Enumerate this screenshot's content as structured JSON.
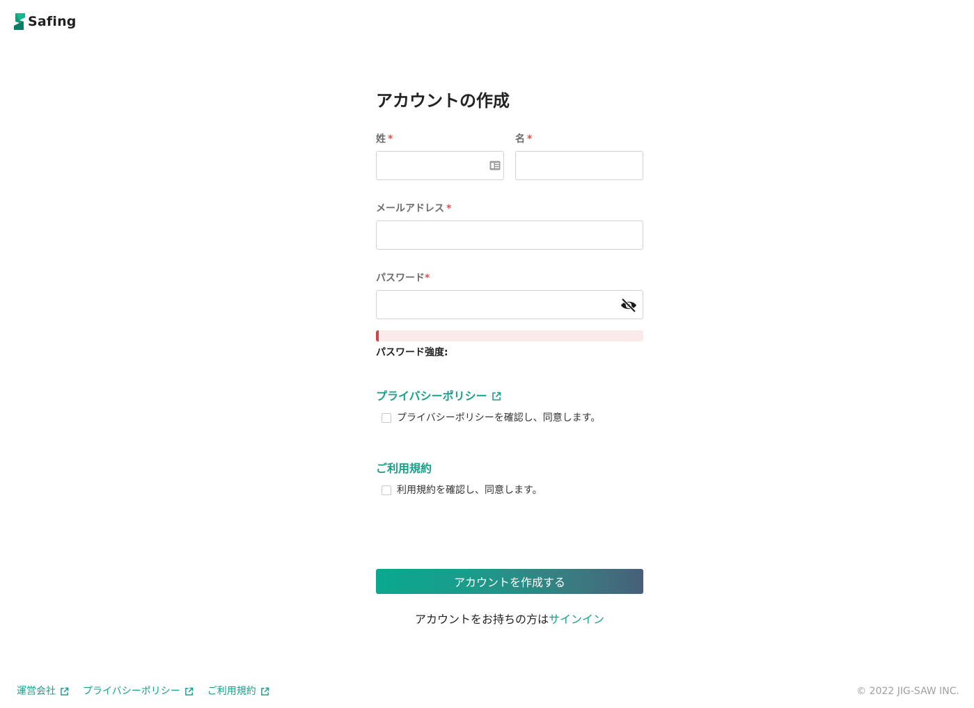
{
  "brand": {
    "name": "Safing",
    "icon": "safing-logo-icon",
    "accent": "#16a08a"
  },
  "form": {
    "title": "アカウントの作成",
    "last_name": {
      "label": "姓",
      "required_mark": "*",
      "value": "",
      "icon": "contact-card-icon"
    },
    "first_name": {
      "label": "名",
      "required_mark": "*",
      "value": ""
    },
    "email": {
      "label": "メールアドレス",
      "required_mark": "*",
      "value": ""
    },
    "password": {
      "label": "パスワード",
      "required_mark": "*",
      "value": "",
      "toggle_icon": "eye-off-icon"
    },
    "strength": {
      "label": "パスワード強度:",
      "level": 0.01,
      "color": "#cc4444",
      "track_color": "#faeaea"
    },
    "privacy": {
      "link": "プライバシーポリシー",
      "checkbox_label": "プライバシーポリシーを確認し、同意します。",
      "checked": false
    },
    "terms": {
      "link": "ご利用規約",
      "checkbox_label": "利用規約を確認し、同意します。",
      "checked": false
    },
    "submit_label": "アカウントを作成する",
    "signin_prompt": "アカウントをお持ちの方は",
    "signin_link": "サインイン"
  },
  "footer": {
    "links": [
      "運営会社",
      "プライバシーポリシー",
      "ご利用規約"
    ],
    "copyright": "© 2022 JIG-SAW INC."
  }
}
